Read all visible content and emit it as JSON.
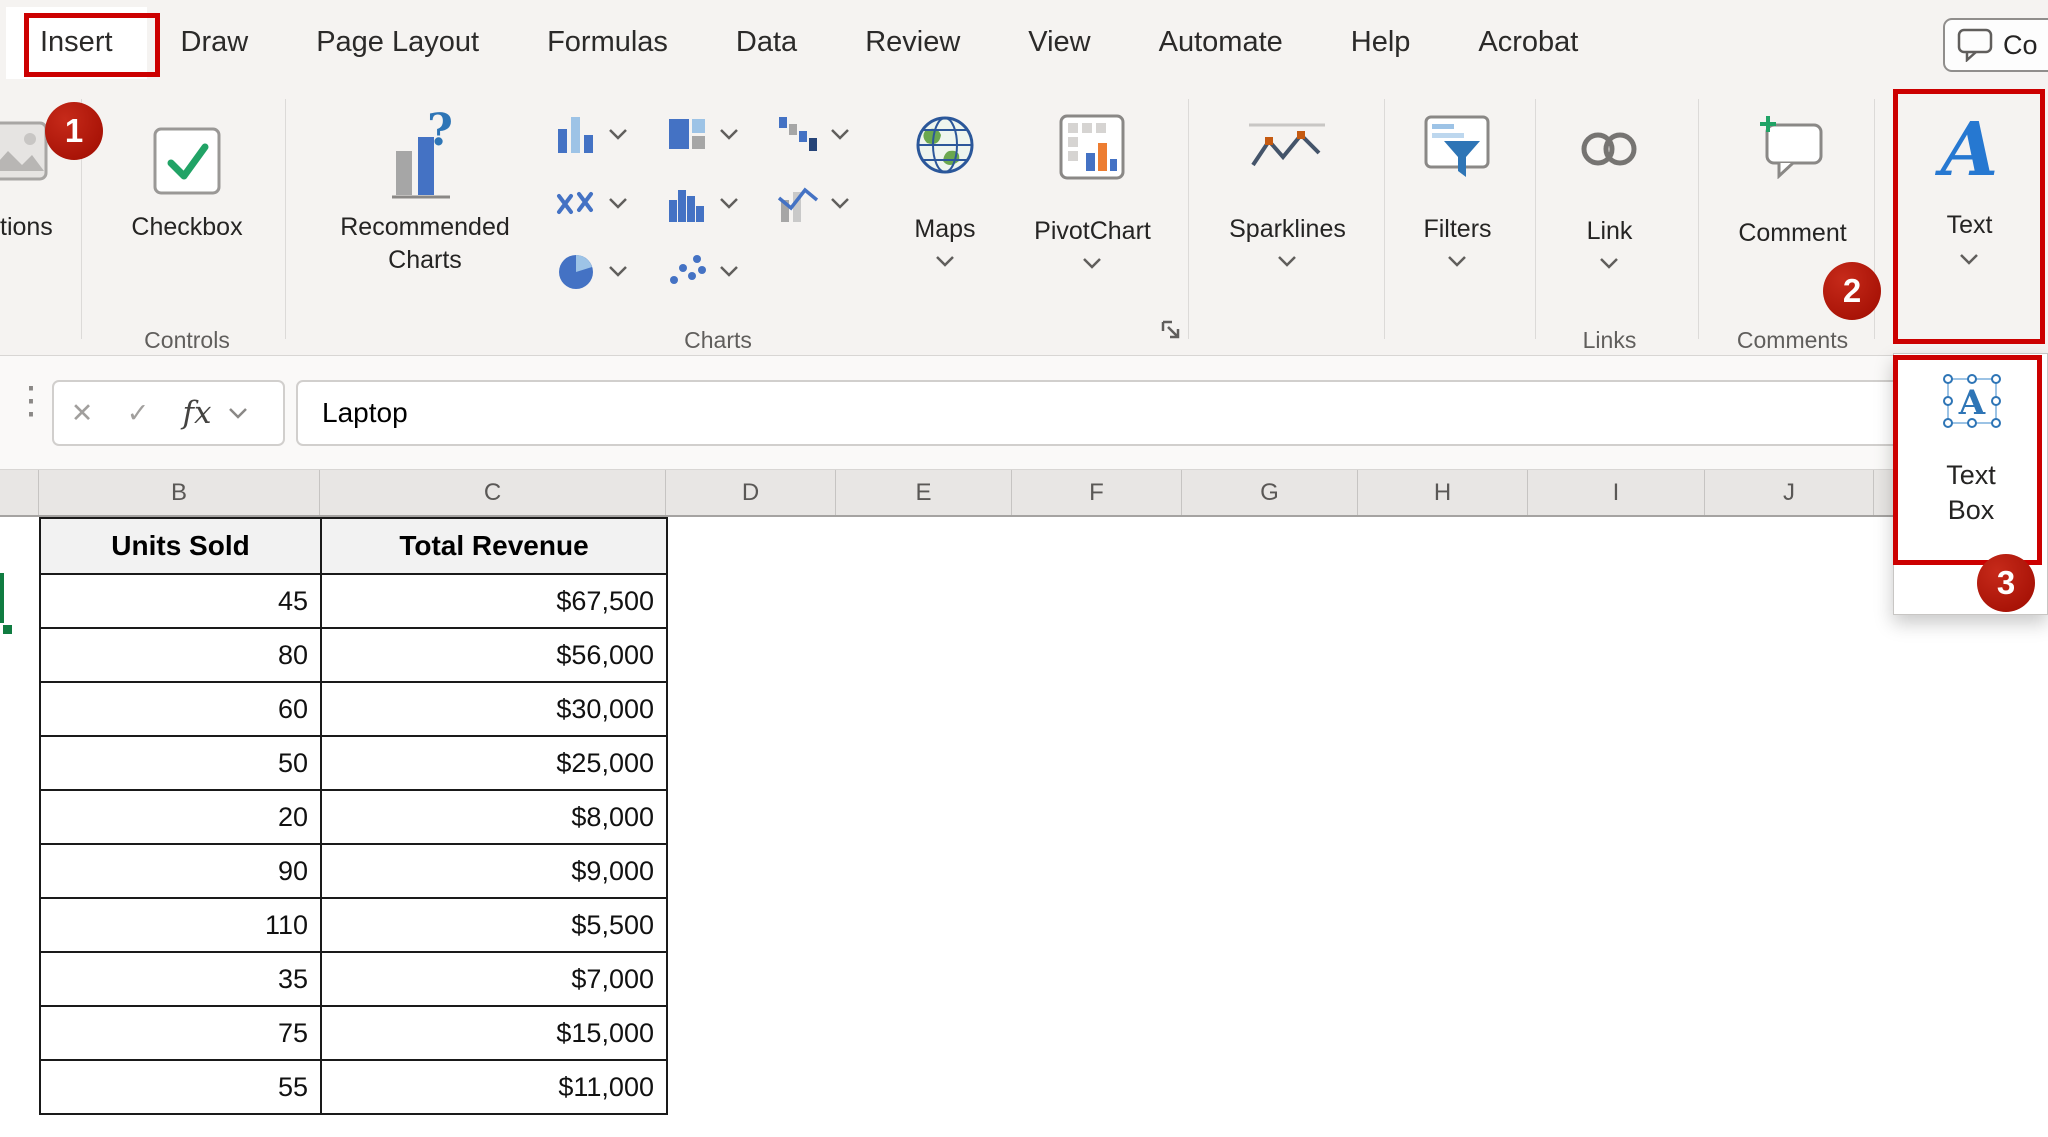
{
  "tabs": {
    "items": [
      {
        "label": "Insert"
      },
      {
        "label": "Draw"
      },
      {
        "label": "Page Layout"
      },
      {
        "label": "Formulas"
      },
      {
        "label": "Data"
      },
      {
        "label": "Review"
      },
      {
        "label": "View"
      },
      {
        "label": "Automate"
      },
      {
        "label": "Help"
      },
      {
        "label": "Acrobat"
      }
    ],
    "selected": "Insert",
    "comments_button_label": "Co"
  },
  "ribbon": {
    "partial_button_label": "tions",
    "checkbox": {
      "label": "Checkbox",
      "group": "Controls"
    },
    "charts": {
      "recommended_label": "Recommended Charts",
      "group": "Charts"
    },
    "maps_label": "Maps",
    "pivotchart_label": "PivotChart",
    "sparklines_label": "Sparklines",
    "filters_label": "Filters",
    "link": {
      "label": "Link",
      "group": "Links"
    },
    "comment": {
      "label": "Comment",
      "group": "Comments"
    },
    "text": {
      "label": "Text",
      "icon_glyph": "A"
    }
  },
  "formula_bar": {
    "fx_label": "fx",
    "value": "Laptop"
  },
  "icons": {
    "cancel": "✕",
    "enter": "✓",
    "grip": "⋮",
    "question": "?"
  },
  "annotations": {
    "step1": "1",
    "step2": "2",
    "step3": "3",
    "color": "#c00000"
  },
  "text_box_menu": {
    "label": "Text Box",
    "icon_glyph": "A"
  },
  "grid": {
    "visible_columns": [
      "B",
      "C",
      "D",
      "E",
      "F",
      "G",
      "H",
      "I",
      "J"
    ],
    "table": {
      "headers": [
        "Units Sold",
        "Total Revenue"
      ],
      "rows": [
        [
          "45",
          "$67,500"
        ],
        [
          "80",
          "$56,000"
        ],
        [
          "60",
          "$30,000"
        ],
        [
          "50",
          "$25,000"
        ],
        [
          "20",
          "$8,000"
        ],
        [
          "90",
          "$9,000"
        ],
        [
          "110",
          "$5,500"
        ],
        [
          "35",
          "$7,000"
        ],
        [
          "75",
          "$15,000"
        ],
        [
          "55",
          "$11,000"
        ]
      ]
    }
  }
}
